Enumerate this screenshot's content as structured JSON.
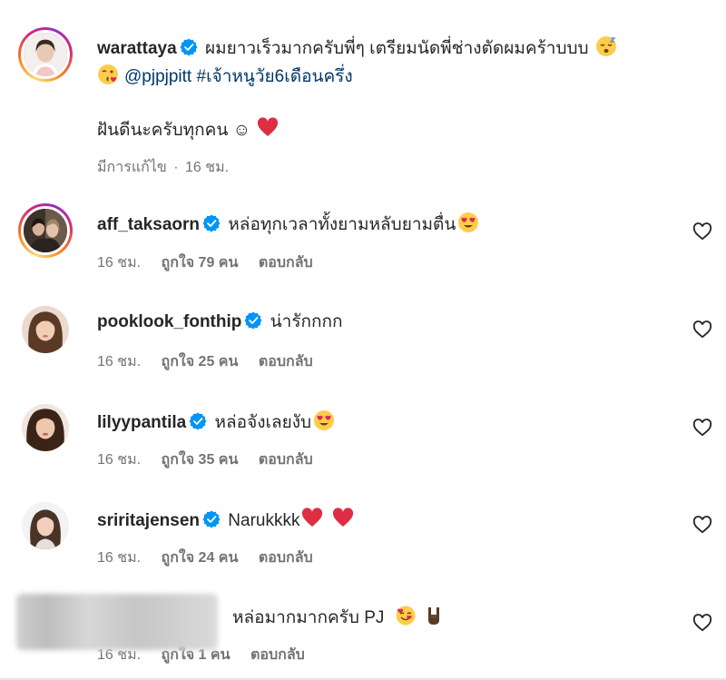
{
  "post": {
    "username": "warattaya",
    "caption_line1": "ผมยาวเร็วมากครับพี่ๆ เตรียมนัดพี่ช่างตัดผมคร้าบบบ",
    "mention": "@pjpjpitt",
    "hashtag": "#เจ้าหนูวัย6เดือนครึ่ง",
    "caption_line2": "ฝันดีนะครับทุกคน ☺",
    "edited_label": "มีการแก้ไข",
    "separator": "·",
    "time": "16 ชม."
  },
  "comments": [
    {
      "username": "aff_taksaorn",
      "text": "หล่อทุกเวลาทั้งยามหลับยามตื่น",
      "time": "16 ชม.",
      "likes": "ถูกใจ 79 คน",
      "reply": "ตอบกลับ"
    },
    {
      "username": "pooklook_fonthip",
      "text": "น่ารักกกก",
      "time": "16 ชม.",
      "likes": "ถูกใจ 25 คน",
      "reply": "ตอบกลับ"
    },
    {
      "username": "lilyypantila",
      "text": "หล่อจังเลยงับ",
      "time": "16 ชม.",
      "likes": "ถูกใจ 35 คน",
      "reply": "ตอบกลับ"
    },
    {
      "username": "sriritajensen",
      "text": "Narukkkk",
      "time": "16 ชม.",
      "likes": "ถูกใจ 24 คน",
      "reply": "ตอบกลับ"
    },
    {
      "username": "",
      "text": "หล่อมากมากครับ PJ",
      "time": "16 ชม.",
      "likes": "ถูกใจ 1 คน",
      "reply": "ตอบกลับ"
    }
  ],
  "colors": {
    "verified": "#0095f6",
    "link": "#00376b",
    "heart": "#ed4956",
    "muted": "#737373"
  },
  "icons": {
    "verified": "verified-badge-icon",
    "like": "heart-outline-icon",
    "emoji_sleep": "sleeping-face-emoji",
    "emoji_kiss": "face-blowing-kiss-emoji",
    "emoji_hearteyes": "heart-eyes-emoji",
    "emoji_heart": "red-heart-emoji",
    "emoji_love": "smiling-face-with-hearts-emoji",
    "emoji_horns": "sign-of-horns-emoji"
  }
}
